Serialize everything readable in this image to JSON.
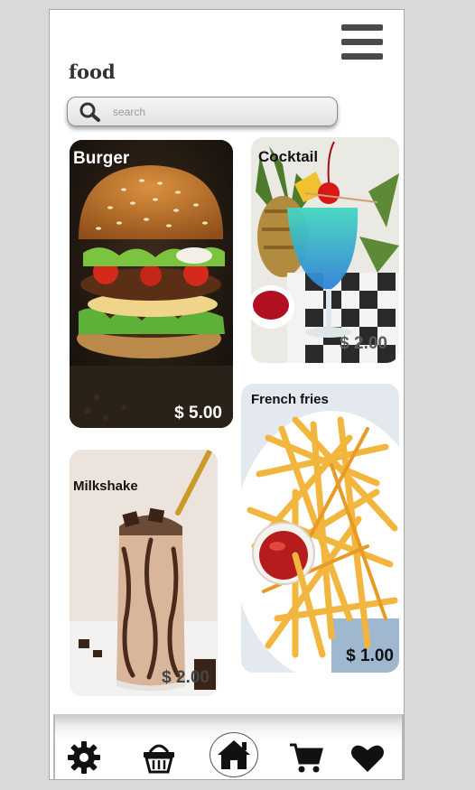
{
  "header": {
    "title": "food",
    "menu_icon": "hamburger-menu-icon"
  },
  "search": {
    "placeholder": "search",
    "value": "",
    "icon": "search-icon"
  },
  "products": [
    {
      "id": "burger",
      "name": "Burger",
      "price": "$ 5.00"
    },
    {
      "id": "cocktail",
      "name": "Cocktail",
      "price": "$ 2.00"
    },
    {
      "id": "fries",
      "name": "French fries",
      "price": "$ 1.00"
    },
    {
      "id": "milkshake",
      "name": "Milkshake",
      "price": "$ 2.00"
    }
  ],
  "bottom_nav": [
    {
      "icon": "gear-icon",
      "active": false
    },
    {
      "icon": "basket-icon",
      "active": false
    },
    {
      "icon": "home-icon",
      "active": true
    },
    {
      "icon": "cart-icon",
      "active": false
    },
    {
      "icon": "heart-icon",
      "active": false
    }
  ],
  "colors": {
    "page_background": "#d9d9d9",
    "screen_background": "#ffffff",
    "icon_dark": "#111111",
    "menu_icon": "#4a4a4a"
  }
}
